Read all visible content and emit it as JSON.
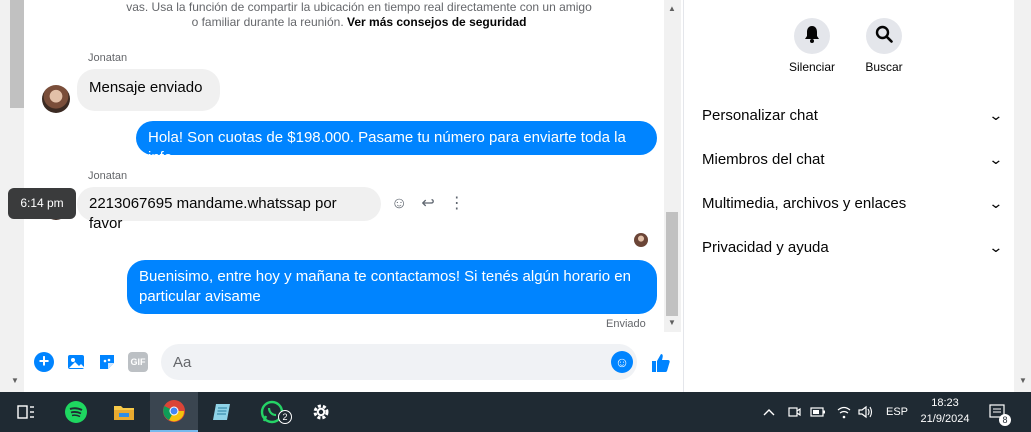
{
  "chat": {
    "safety_text": "vas. Usa la función de compartir la ubicación en tiempo real directamente con un amigo o familiar durante la reunión.",
    "safety_link": "Ver más consejos de seguridad",
    "messages": [
      {
        "sender": "Jonatan",
        "text": "Mensaje enviado"
      },
      {
        "text": "Hola! Son cuotas de $198.000. Pasame tu número para enviarte toda la info"
      },
      {
        "sender": "Jonatan",
        "text": "2213067695 mandame.whatssap por favor",
        "time": "6:14 pm"
      },
      {
        "text": "Buenisimo, entre hoy y mañana te contactamos! Si tenés algún horario en particular avisame",
        "status": "Enviado"
      }
    ],
    "composer": {
      "placeholder": "Aa",
      "gif_label": "GIF"
    }
  },
  "details": {
    "actions": [
      {
        "label": "Silenciar",
        "icon": "bell-icon"
      },
      {
        "label": "Buscar",
        "icon": "search-icon"
      }
    ],
    "sections": [
      "Personalizar chat",
      "Miembros del chat",
      "Multimedia, archivos y enlaces",
      "Privacidad y ayuda"
    ]
  },
  "taskbar": {
    "whatsapp_badge": "2",
    "lang": "ESP",
    "time": "18:23",
    "date": "21/9/2024",
    "notifications": "8"
  },
  "colors": {
    "accent": "#0084ff",
    "taskbar": "#1f2a33"
  }
}
